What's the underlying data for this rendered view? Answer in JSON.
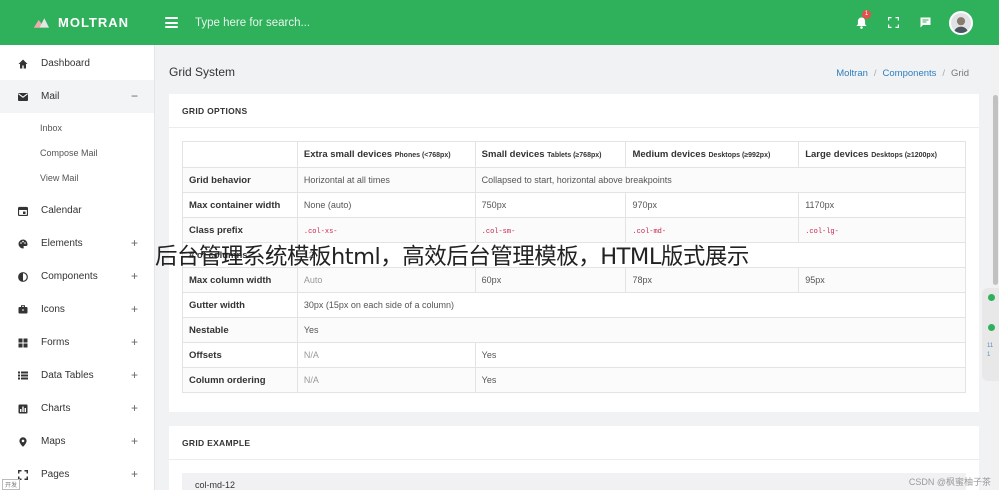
{
  "brand": {
    "name": "MOLTRAN"
  },
  "search": {
    "placeholder": "Type here for search..."
  },
  "header": {
    "notification_count": "1"
  },
  "sidebar": {
    "items": [
      {
        "label": "Dashboard",
        "icon": "home-icon"
      },
      {
        "label": "Mail",
        "icon": "envelope-icon",
        "toggle": "−"
      },
      {
        "label": "Calendar",
        "icon": "calendar-icon"
      },
      {
        "label": "Elements",
        "icon": "palette-icon",
        "toggle": "+"
      },
      {
        "label": "Components",
        "icon": "contrast-icon",
        "toggle": "+"
      },
      {
        "label": "Icons",
        "icon": "briefcase-icon",
        "toggle": "+"
      },
      {
        "label": "Forms",
        "icon": "grid-icon",
        "toggle": "+"
      },
      {
        "label": "Data Tables",
        "icon": "list-icon",
        "toggle": "+"
      },
      {
        "label": "Charts",
        "icon": "chart-icon",
        "toggle": "+"
      },
      {
        "label": "Maps",
        "icon": "map-marker-icon",
        "toggle": "+"
      },
      {
        "label": "Pages",
        "icon": "expand-icon",
        "toggle": "+"
      }
    ],
    "mail_sub": [
      "Inbox",
      "Compose Mail",
      "View Mail"
    ]
  },
  "page": {
    "title": "Grid System",
    "breadcrumb": [
      "Moltran",
      "Components",
      "Grid"
    ]
  },
  "grid_options": {
    "title": "GRID OPTIONS",
    "headers": [
      {
        "main": "",
        "small": ""
      },
      {
        "main": "Extra small devices",
        "small": "Phones (<768px)"
      },
      {
        "main": "Small devices",
        "small": "Tablets (≥768px)"
      },
      {
        "main": "Medium devices",
        "small": "Desktops (≥992px)"
      },
      {
        "main": "Large devices",
        "small": "Desktops (≥1200px)"
      }
    ],
    "rows": {
      "grid_behavior": {
        "label": "Grid behavior",
        "xs": "Horizontal at all times",
        "rest": "Collapsed to start, horizontal above breakpoints"
      },
      "max_container": {
        "label": "Max container width",
        "xs": "None (auto)",
        "sm": "750px",
        "md": "970px",
        "lg": "1170px"
      },
      "class_prefix": {
        "label": "Class prefix",
        "xs": ".col-xs-",
        "sm": ".col-sm-",
        "md": ".col-md-",
        "lg": ".col-lg-"
      },
      "num_columns": {
        "label": "# of columns",
        "value": "12"
      },
      "max_col_width": {
        "label": "Max column width",
        "xs": "Auto",
        "sm": "60px",
        "md": "78px",
        "lg": "95px"
      },
      "gutter": {
        "label": "Gutter width",
        "value": "30px (15px on each side of a column)"
      },
      "nestable": {
        "label": "Nestable",
        "value": "Yes"
      },
      "offsets": {
        "label": "Offsets",
        "xs": "N/A",
        "rest": "Yes"
      },
      "ordering": {
        "label": "Column ordering",
        "xs": "N/A",
        "rest": "Yes"
      }
    }
  },
  "grid_example": {
    "title": "GRID EXAMPLE",
    "first_row": "col-md-12"
  },
  "overlay_caption": "后台管理系统模板html，高效后台管理模板，HTML版式展示",
  "watermark": "CSDN @枫蜜柚子茶",
  "corner_tag": "开发",
  "float_panel": {
    "labels": [
      "11",
      "1"
    ]
  },
  "colors": {
    "primary": "#2fb05a",
    "link": "#2f7fbd",
    "code": "#c7254e",
    "badge": "#e94e4e"
  }
}
